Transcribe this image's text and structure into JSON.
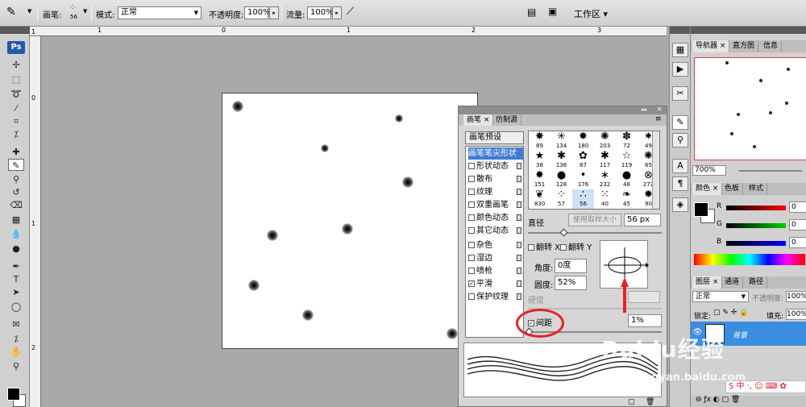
{
  "options_bar": {
    "brush_label": "画笔:",
    "brush_size": "56",
    "mode_label": "模式:",
    "mode_value": "正常",
    "opacity_label": "不透明度:",
    "opacity_value": "100%",
    "flow_label": "流量:",
    "flow_value": "100%",
    "workspace_label": "工作区 ▾"
  },
  "toolbox": {
    "logo": "Ps"
  },
  "rulers": {
    "top": [
      "1",
      "0",
      "1",
      "2",
      "3"
    ],
    "left": [
      "1",
      "0",
      "1",
      "2"
    ]
  },
  "brush_panel": {
    "tabs": [
      "画笔",
      "仿制源"
    ],
    "presets_button": "画笔预设",
    "items": [
      {
        "label": "画笔笔尖形状",
        "checked": null,
        "selected": true
      },
      {
        "label": "形状动态",
        "checked": false
      },
      {
        "label": "散布",
        "checked": false
      },
      {
        "label": "纹理",
        "checked": false
      },
      {
        "label": "双重画笔",
        "checked": false
      },
      {
        "label": "颜色动态",
        "checked": false
      },
      {
        "label": "其它动态",
        "checked": false
      },
      {
        "label": "杂色",
        "checked": false
      },
      {
        "label": "湿边",
        "checked": false
      },
      {
        "label": "喷枪",
        "checked": false
      },
      {
        "label": "平滑",
        "checked": true
      },
      {
        "label": "保护纹理",
        "checked": false
      }
    ],
    "tips": [
      {
        "icon": "✸",
        "n": "89"
      },
      {
        "icon": "✳",
        "n": "134"
      },
      {
        "icon": "✹",
        "n": "180"
      },
      {
        "icon": "✺",
        "n": "203"
      },
      {
        "icon": "✽",
        "n": "72"
      },
      {
        "icon": "✷",
        "n": "49"
      },
      {
        "icon": "★",
        "n": "38"
      },
      {
        "icon": "✱",
        "n": "136"
      },
      {
        "icon": "✿",
        "n": "87"
      },
      {
        "icon": "✱",
        "n": "117"
      },
      {
        "icon": "☆",
        "n": "119"
      },
      {
        "icon": "✺",
        "n": "65"
      },
      {
        "icon": "✹",
        "n": "151"
      },
      {
        "icon": "●",
        "n": "128"
      },
      {
        "icon": "•",
        "n": "176"
      },
      {
        "icon": "∗",
        "n": "232"
      },
      {
        "icon": "●",
        "n": "48"
      },
      {
        "icon": "⊗",
        "n": "272"
      },
      {
        "icon": "❦",
        "n": "830"
      },
      {
        "icon": "⁘",
        "n": "57"
      },
      {
        "icon": "∴",
        "n": "56"
      },
      {
        "icon": "⁙",
        "n": "40"
      },
      {
        "icon": "❧",
        "n": "45"
      },
      {
        "icon": "✹",
        "n": "90"
      }
    ],
    "diameter_label": "直径",
    "use_sample_button": "使用取样大小",
    "diameter_value": "56 px",
    "flip_x": "翻转 X",
    "flip_y": "翻转 Y",
    "angle_label": "角度:",
    "angle_value": "0度",
    "roundness_label": "圆度:",
    "roundness_value": "52%",
    "hardness_label": "硬度",
    "spacing_label": "间距",
    "spacing_checked": true,
    "spacing_value": "1%"
  },
  "right_panels": {
    "nav_tabs": [
      "导航器",
      "直方图",
      "信息"
    ],
    "zoom": "700%",
    "color_tabs": [
      "颜色",
      "色板",
      "样式"
    ],
    "channels": [
      {
        "name": "R",
        "value": "0",
        "color": "#e02020"
      },
      {
        "name": "G",
        "value": "0",
        "color": "#20c020"
      },
      {
        "name": "B",
        "value": "0",
        "color": "#2040e0"
      }
    ],
    "layer_tabs": [
      "图层",
      "通道",
      "路径"
    ],
    "blend_mode": "正常",
    "layer_opacity_label": "不透明度:",
    "layer_opacity_value": "100%",
    "lock_label": "锁定:",
    "fill_label": "填充:",
    "fill_value": "100%",
    "layer_name": "背景"
  },
  "colors": {
    "accent": "#3f7cd4",
    "annotation_red": "#e8202a"
  },
  "watermark": {
    "logo": "Baidu经验",
    "url": "jingyan.baidu.com"
  }
}
